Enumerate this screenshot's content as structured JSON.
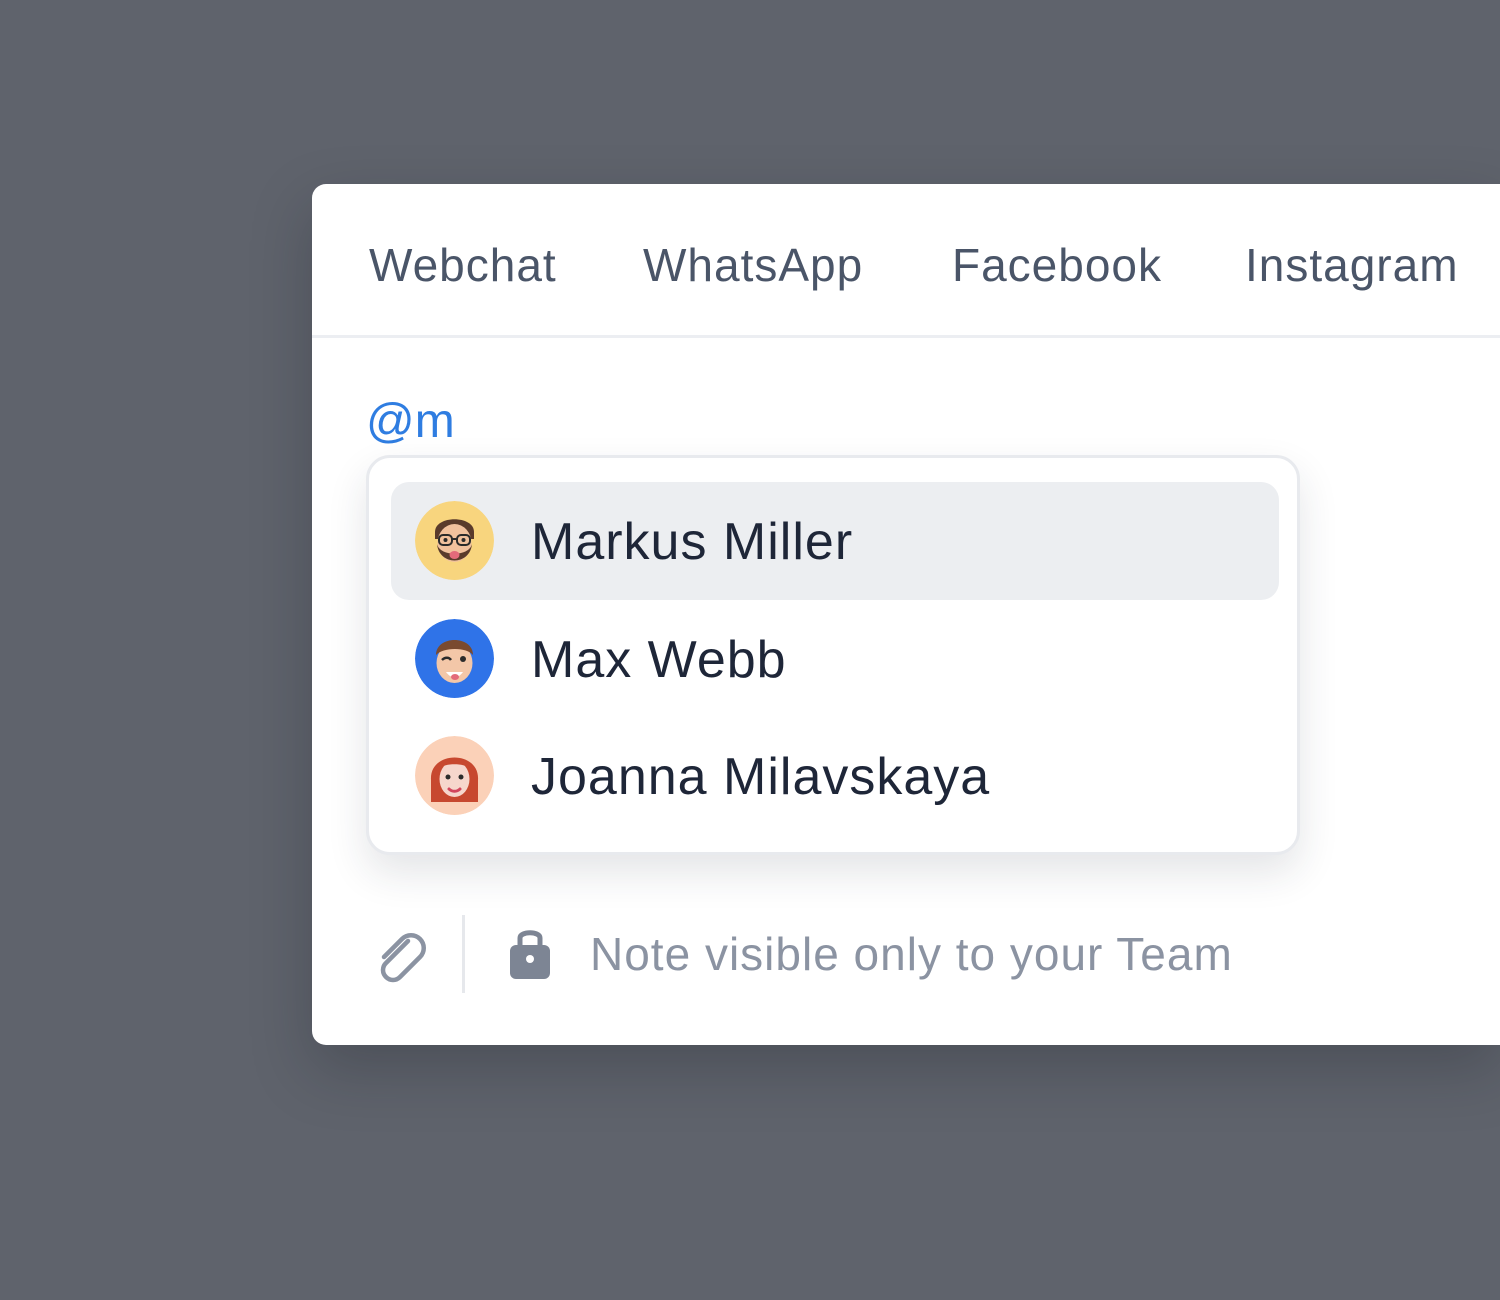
{
  "tabs": [
    {
      "label": "Webchat"
    },
    {
      "label": "WhatsApp"
    },
    {
      "label": "Facebook"
    },
    {
      "label": "Instagram"
    }
  ],
  "composer": {
    "mention_query": "@m"
  },
  "mention_list": {
    "options": [
      {
        "name": "Markus Miller",
        "avatar_color": "#f8d57e",
        "selected": true
      },
      {
        "name": "Max Webb",
        "avatar_color": "#2f73e8",
        "selected": false
      },
      {
        "name": "Joanna Milavskaya",
        "avatar_color": "#fbd1b8",
        "selected": false
      }
    ]
  },
  "footer": {
    "attach_icon": "paperclip-icon",
    "lock_icon": "lock-icon",
    "note_text": "Note visible only to your Team"
  },
  "colors": {
    "background": "#5f636c",
    "panel": "#ffffff",
    "mention_accent": "#2f7de1",
    "selected_row": "#eceef1",
    "muted_text": "#8b93a2"
  }
}
